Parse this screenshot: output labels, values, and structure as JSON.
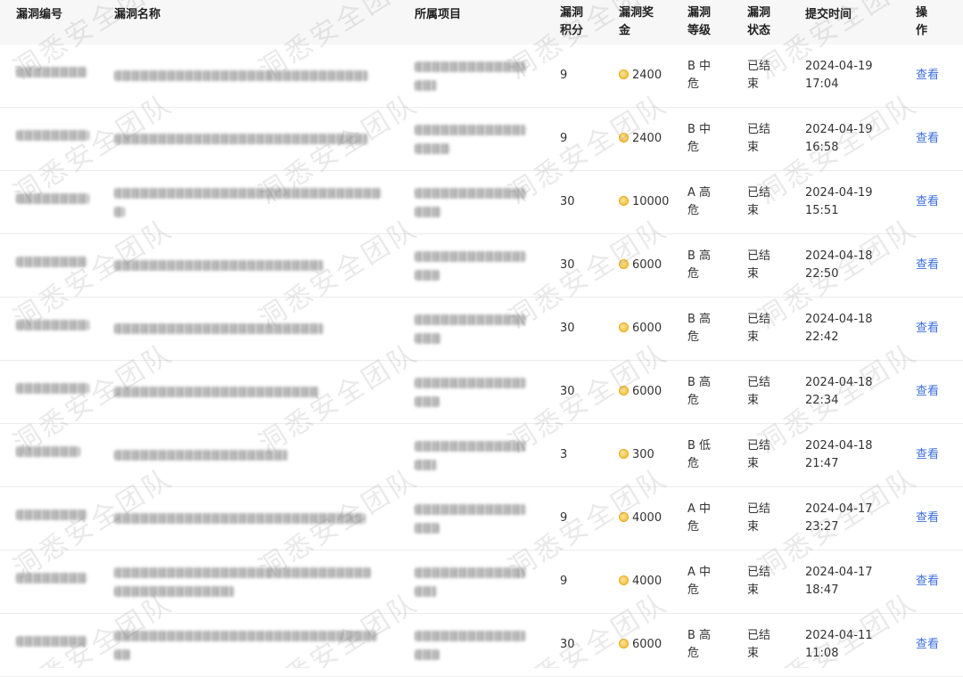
{
  "headers": {
    "id": "漏洞编号",
    "name": "漏洞名称",
    "project": "所属项目",
    "score": [
      "漏洞",
      "积分"
    ],
    "bounty": [
      "漏洞奖",
      "金"
    ],
    "level": [
      "漏洞",
      "等级"
    ],
    "status": [
      "漏洞",
      "状态"
    ],
    "time": "提交时间",
    "op": [
      "操",
      "作"
    ]
  },
  "rows": [
    {
      "score": "9",
      "bounty": "2400",
      "level": [
        "B 中",
        "危"
      ],
      "status": [
        "已结",
        "束"
      ],
      "date": "2024-04-19",
      "time": "17:04",
      "action": "查看"
    },
    {
      "score": "9",
      "bounty": "2400",
      "level": [
        "B 中",
        "危"
      ],
      "status": [
        "已结",
        "束"
      ],
      "date": "2024-04-19",
      "time": "16:58",
      "action": "查看"
    },
    {
      "score": "30",
      "bounty": "10000",
      "level": [
        "A 高",
        "危"
      ],
      "status": [
        "已结",
        "束"
      ],
      "date": "2024-04-19",
      "time": "15:51",
      "action": "查看"
    },
    {
      "score": "30",
      "bounty": "6000",
      "level": [
        "B 高",
        "危"
      ],
      "status": [
        "已结",
        "束"
      ],
      "date": "2024-04-18",
      "time": "22:50",
      "action": "查看"
    },
    {
      "score": "30",
      "bounty": "6000",
      "level": [
        "B 高",
        "危"
      ],
      "status": [
        "已结",
        "束"
      ],
      "date": "2024-04-18",
      "time": "22:42",
      "action": "查看"
    },
    {
      "score": "30",
      "bounty": "6000",
      "level": [
        "B 高",
        "危"
      ],
      "status": [
        "已结",
        "束"
      ],
      "date": "2024-04-18",
      "time": "22:34",
      "action": "查看"
    },
    {
      "score": "3",
      "bounty": "300",
      "level": [
        "B 低",
        "危"
      ],
      "status": [
        "已结",
        "束"
      ],
      "date": "2024-04-18",
      "time": "21:47",
      "action": "查看"
    },
    {
      "score": "9",
      "bounty": "4000",
      "level": [
        "A 中",
        "危"
      ],
      "status": [
        "已结",
        "束"
      ],
      "date": "2024-04-17",
      "time": "23:27",
      "action": "查看"
    },
    {
      "score": "9",
      "bounty": "4000",
      "level": [
        "A 中",
        "危"
      ],
      "status": [
        "已结",
        "束"
      ],
      "date": "2024-04-17",
      "time": "18:47",
      "action": "查看"
    },
    {
      "score": "30",
      "bounty": "6000",
      "level": [
        "B 高",
        "危"
      ],
      "status": [
        "已结",
        "束"
      ],
      "date": "2024-04-11",
      "time": "11:08",
      "action": "查看"
    }
  ],
  "watermark": "洞悉安全团队",
  "colors": {
    "link": "#3d6fe0",
    "header_bg": "#f7f7f7",
    "coin": "#f2b62c"
  },
  "icons": {
    "bounty": "coin-icon"
  }
}
